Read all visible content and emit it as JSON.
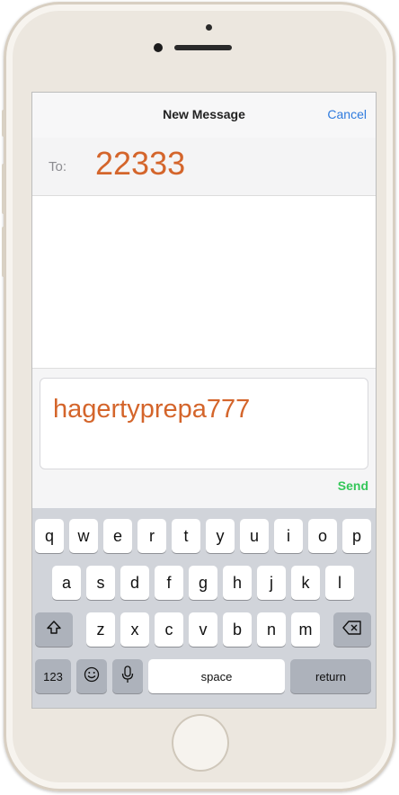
{
  "header": {
    "title": "New Message",
    "cancel_label": "Cancel"
  },
  "to": {
    "label": "To:",
    "value": "22333"
  },
  "compose": {
    "text": "hagertyprepa777",
    "send_label": "Send"
  },
  "keyboard": {
    "row1": [
      "q",
      "w",
      "e",
      "r",
      "t",
      "y",
      "u",
      "i",
      "o",
      "p"
    ],
    "row2": [
      "a",
      "s",
      "d",
      "f",
      "g",
      "h",
      "j",
      "k",
      "l"
    ],
    "row3": [
      "z",
      "x",
      "c",
      "v",
      "b",
      "n",
      "m"
    ],
    "numbers_label": "123",
    "space_label": "space",
    "return_label": "return",
    "icons": {
      "shift": "shift-icon",
      "delete": "delete-icon",
      "emoji": "emoji-icon",
      "mic": "mic-icon"
    }
  },
  "colors": {
    "accent_text": "#d4652b",
    "cancel": "#2f7bde",
    "send": "#35c75a"
  }
}
